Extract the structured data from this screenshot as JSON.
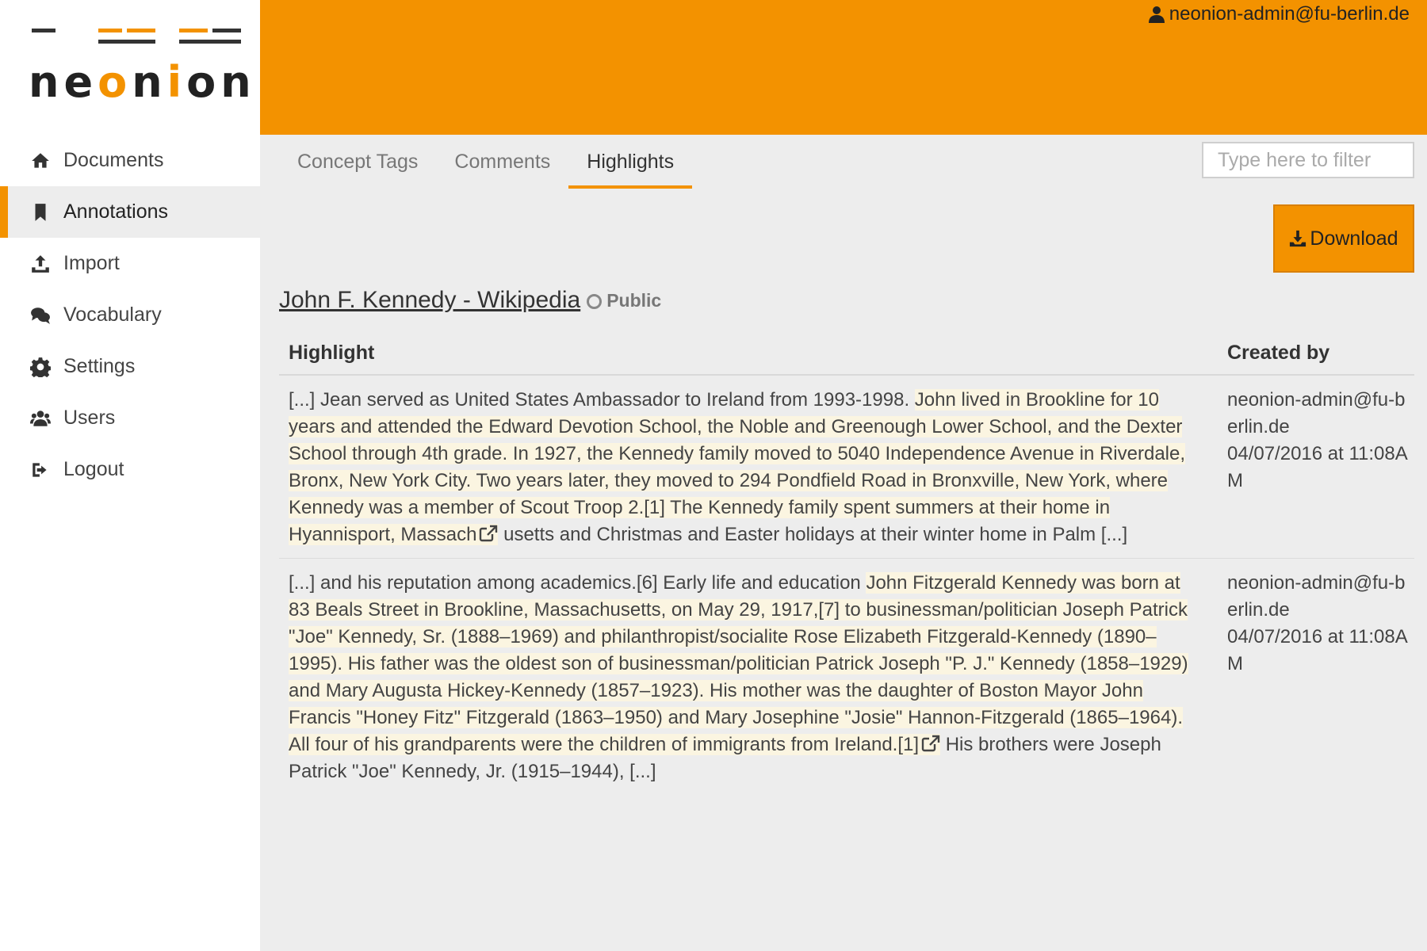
{
  "app": {
    "logo_text": "neonion",
    "brand_color": "#f39200"
  },
  "header": {
    "user_email": "neonion-admin@fu-berlin.de"
  },
  "sidebar": {
    "items": [
      {
        "label": "Documents",
        "icon": "home-icon"
      },
      {
        "label": "Annotations",
        "icon": "bookmark-icon",
        "active": true
      },
      {
        "label": "Import",
        "icon": "upload-icon"
      },
      {
        "label": "Vocabulary",
        "icon": "comments-icon"
      },
      {
        "label": "Settings",
        "icon": "gear-icon"
      },
      {
        "label": "Users",
        "icon": "users-icon"
      },
      {
        "label": "Logout",
        "icon": "sign-out-icon"
      }
    ]
  },
  "tabs": [
    {
      "label": "Concept Tags"
    },
    {
      "label": "Comments"
    },
    {
      "label": "Highlights",
      "active": true
    }
  ],
  "filter": {
    "placeholder": "Type here to filter",
    "value": ""
  },
  "download": {
    "label": "Download"
  },
  "document": {
    "title": "John F. Kennedy - Wikipedia",
    "visibility": "Public"
  },
  "table": {
    "columns": {
      "highlight": "Highlight",
      "created_by": "Created by"
    },
    "rows": [
      {
        "before": "[...] Jean served as United States Ambassador to Ireland from 1993-1998. ",
        "highlight": "John lived in Brookline for 10 years and attended the Edward Devotion School, the Noble and Greenough Lower School, and the Dexter School through 4th grade. In 1927, the Kennedy family moved to 5040 Independence Avenue in Riverdale, Bronx, New York City. Two years later, they moved to 294 Pondfield Road in Bronxville, New York, where Kennedy was a member of Scout Troop 2.[1] The Kennedy family spent summers at their home in Hyannisport, Massach",
        "after": " usetts and Christmas and Easter holidays at their winter home in Palm [...]",
        "author": "neonion-admin@fu-berlin.de",
        "date": "04/07/2016 at 11:08AM"
      },
      {
        "before": "[...] and his reputation among academics.[6] Early life and education ",
        "highlight": "John Fitzgerald Kennedy was born at 83 Beals Street in Brookline, Massachusetts, on May 29, 1917,[7] to businessman/politician Joseph Patrick \"Joe\" Kennedy, Sr. (1888–1969) and philanthropist/socialite Rose Elizabeth Fitzgerald-Kennedy (1890–1995). His father was the oldest son of businessman/politician Patrick Joseph \"P. J.\" Kennedy (1858–1929) and Mary Augusta Hickey-Kennedy (1857–1923). His mother was the daughter of Boston Mayor John Francis \"Honey Fitz\" Fitzgerald (1863–1950) and Mary Josephine \"Josie\" Hannon-Fitzgerald (1865–1964). All four of his grandparents were the children of immigrants from Ireland.[1]",
        "after": " His brothers were Joseph Patrick \"Joe\" Kennedy, Jr. (1915–1944), [...]",
        "author": "neonion-admin@fu-berlin.de",
        "date": "04/07/2016 at 11:08AM"
      }
    ]
  }
}
